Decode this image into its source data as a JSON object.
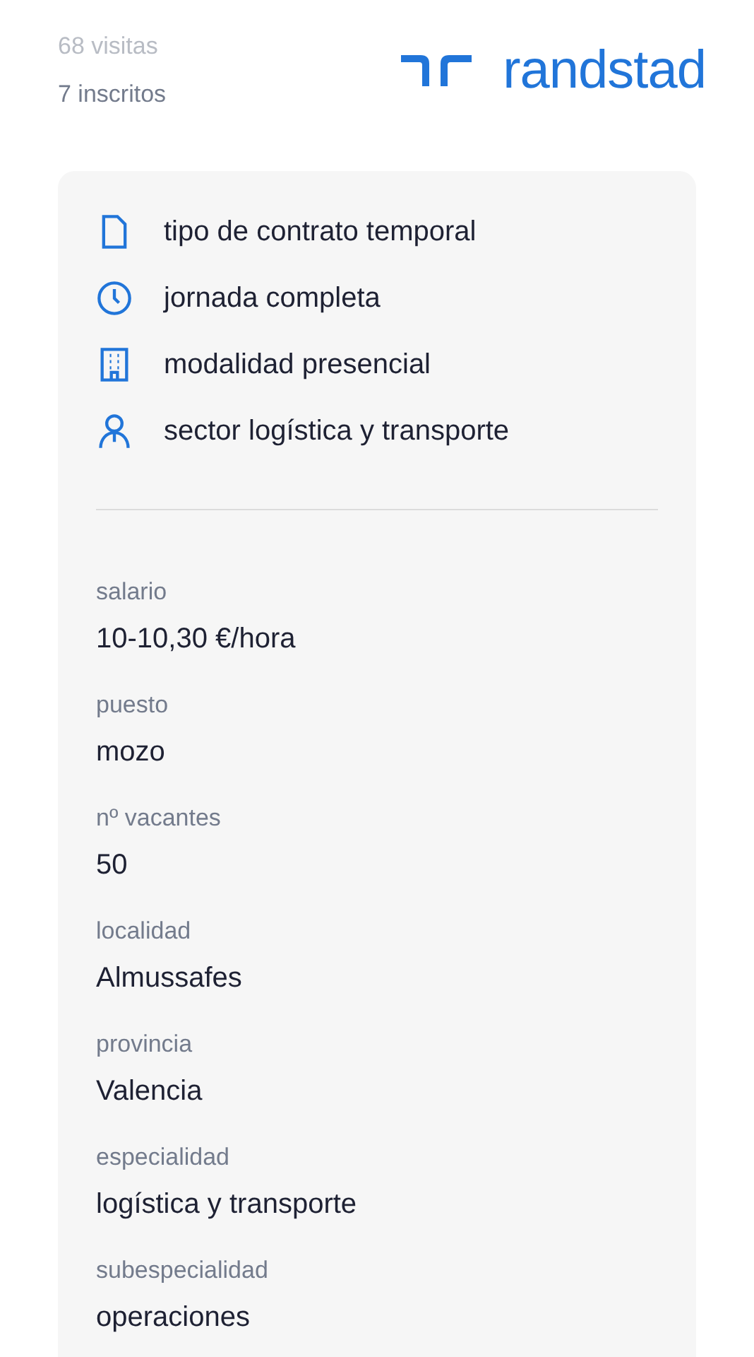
{
  "header": {
    "visits": "68 visitas",
    "applicants": "7 inscritos",
    "logo_text": "randstad"
  },
  "features": [
    {
      "kind": "document",
      "text": "tipo de contrato temporal"
    },
    {
      "kind": "clock",
      "text": "jornada completa"
    },
    {
      "kind": "building",
      "text": "modalidad presencial"
    },
    {
      "kind": "person",
      "text": "sector logística y transporte"
    }
  ],
  "details": [
    {
      "label": "salario",
      "value": "10-10,30 €/hora"
    },
    {
      "label": "puesto",
      "value": "mozo"
    },
    {
      "label": "nº vacantes",
      "value": "50"
    },
    {
      "label": "localidad",
      "value": "Almussafes"
    },
    {
      "label": "provincia",
      "value": "Valencia"
    },
    {
      "label": "especialidad",
      "value": "logística y transporte"
    },
    {
      "label": "subespecialidad",
      "value": "operaciones"
    }
  ]
}
